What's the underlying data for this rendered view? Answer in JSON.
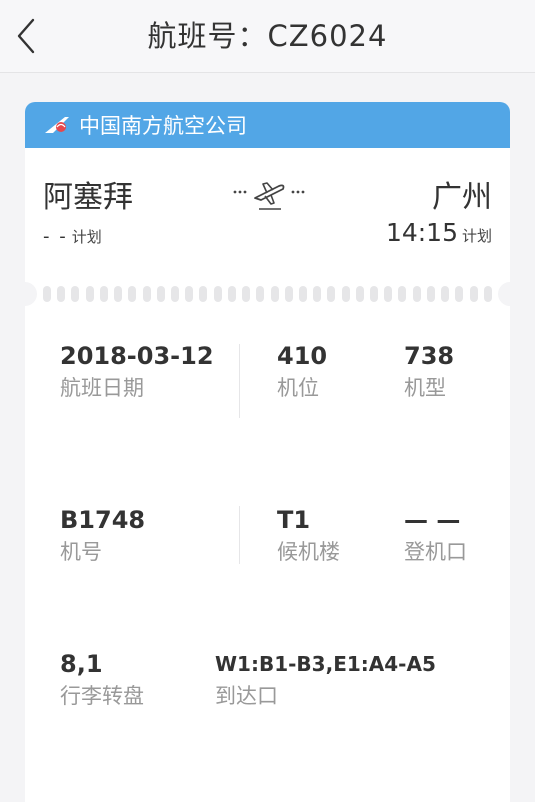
{
  "header": {
    "title": "航班号：CZ6024",
    "back_icon": "chevron-left-icon"
  },
  "airline": {
    "name": "中国南方航空公司",
    "color": "#52a6e6"
  },
  "route": {
    "departure_city": "阿塞拜",
    "arrival_city": "广州",
    "departure_time": "- -",
    "departure_time_tag": "计划",
    "arrival_time": "14:15",
    "arrival_time_tag": "计划"
  },
  "details": {
    "date": {
      "value": "2018-03-12",
      "label": "航班日期"
    },
    "stand": {
      "value": "410",
      "label": "机位"
    },
    "aircraft_type": {
      "value": "738",
      "label": "机型"
    },
    "aircraft_no": {
      "value": "B1748",
      "label": "机号"
    },
    "terminal": {
      "value": "T1",
      "label": "候机楼"
    },
    "gate": {
      "value": "— —",
      "label": "登机口"
    },
    "baggage": {
      "value": "8,1",
      "label": "行李转盘"
    },
    "arrival_exit": {
      "value": "W1:B1-B3,E1:A4-A5",
      "label": "到达口"
    }
  }
}
